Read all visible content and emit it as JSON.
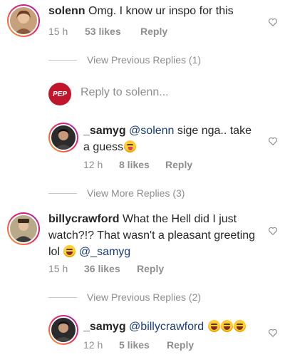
{
  "comments": [
    {
      "username": "solenn",
      "text": "Omg. I know ur inspo for this",
      "time": "15 h",
      "likes": "53 likes",
      "reply": "Reply"
    },
    {
      "username": "_samyg",
      "mention": "@solenn",
      "text": "sige nga.. take a guess",
      "time": "12 h",
      "likes": "8 likes",
      "reply": "Reply"
    },
    {
      "username": "billycrawford",
      "text": "What the Hell did I just watch?!? That wasn't a pleasant greeting lol",
      "mention": "@_samyg",
      "time": "15 h",
      "likes": "36 likes",
      "reply": "Reply"
    },
    {
      "username": "_samyg",
      "mention": "@billycrawford",
      "time": "12 h",
      "likes": "5 likes",
      "reply": "Reply"
    }
  ],
  "thread_toggles": {
    "first": "View Previous Replies (1)",
    "second": "View More Replies (3)",
    "third": "View Previous Replies (2)"
  },
  "reply_box": {
    "avatar_label": "PEP",
    "placeholder": "Reply to solenn..."
  },
  "colors": {
    "mention": "#1a3d7c",
    "muted": "#8e8e8e",
    "pep_logo": "#c0152a"
  }
}
